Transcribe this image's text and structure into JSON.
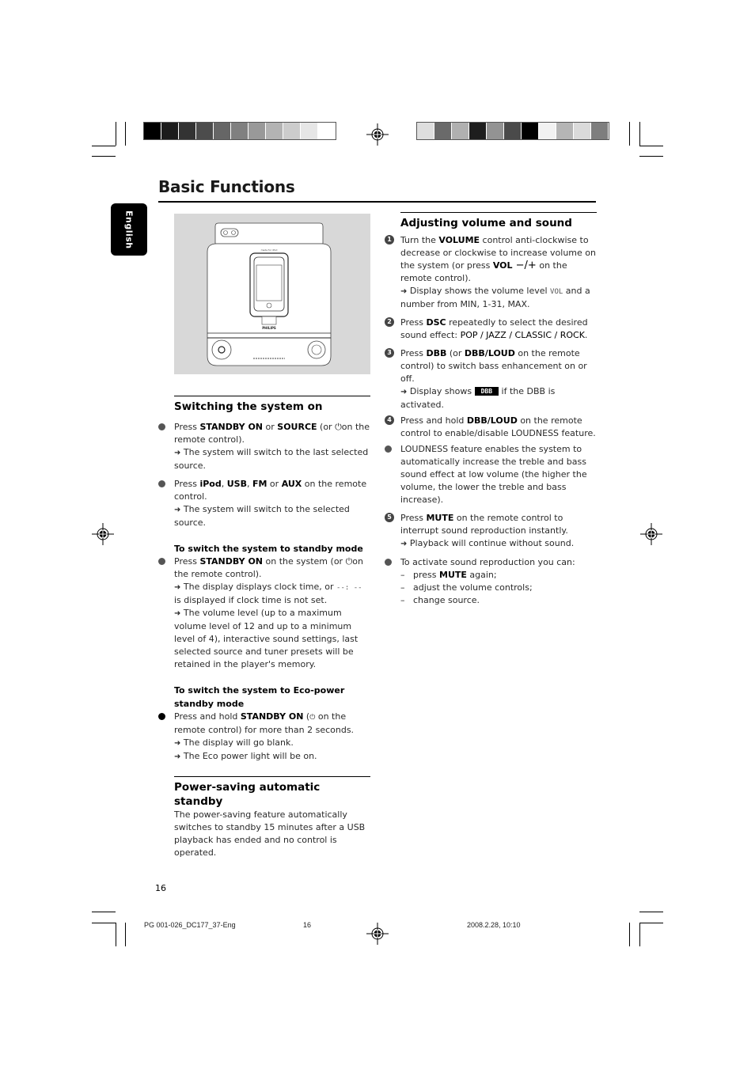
{
  "header": {
    "swatches_left": [
      "#000000",
      "#1c1c1c",
      "#333333",
      "#4c4c4c",
      "#666666",
      "#808080",
      "#999999",
      "#b3b3b3",
      "#cccccc",
      "#e6e6e6",
      "#ffffff"
    ],
    "swatches_right": [
      "#dedede",
      "#6a6a6a",
      "#b0b0b0",
      "#1e1e1e",
      "#939393",
      "#4a4a4a",
      "#000000",
      "#f2f2f2",
      "#b5b5b5",
      "#dadada",
      "#7e7e7e"
    ]
  },
  "page": {
    "title": "Basic Functions",
    "language_tab": "English",
    "page_number": "16"
  },
  "illustration": {
    "brand": "PHILIPS",
    "description": "iPod docking speaker system front view"
  },
  "left": {
    "switch_on": {
      "heading": "Switching the system on",
      "items": [
        {
          "press": "Press ",
          "k1": "STANDBY ON",
          "or": " or ",
          "k2": "SOURCE",
          "tail1": " (or ",
          "tail2": "on the remote control).",
          "result": " The system will switch to the last selected source."
        },
        {
          "press": "Press ",
          "k1": "iPod",
          "c1": ", ",
          "k2": "USB",
          "c2": ", ",
          "k3": "FM",
          "or": " or  ",
          "k4": "AUX",
          "tail": " on the remote control.",
          "result": " The system will switch to the selected source."
        }
      ]
    },
    "standby": {
      "heading": "To switch the system to standby mode",
      "press": "Press ",
      "key": "STANDBY ON",
      "tail1": " on the system (or ",
      "tail2": "on the  remote control).",
      "result1a": " The display displays clock time, or ",
      "clock_blank": "--:  --",
      "result1b": "  is displayed if clock time is not set.",
      "result2": " The volume level (up to a maximum volume level of 12 and up to a minimum level of 4), interactive sound settings, last selected source and tuner presets will be retained in the player's memory."
    },
    "eco": {
      "heading": "To switch the system to Eco-power standby mode",
      "press": "Press and hold ",
      "key": "STANDBY ON",
      "tail1": " (",
      "tail2": " on the remote control) for more than 2 seconds.",
      "result1": " The display will go blank.",
      "result2": " The Eco power light will be on."
    },
    "power_saving": {
      "heading": "Power-saving automatic standby",
      "body": "The power-saving feature automatically switches to standby 15 minutes after a USB playback has ended and no control is operated."
    }
  },
  "right": {
    "heading": "Adjusting volume and sound",
    "step1": {
      "num": "1",
      "a": "Turn the ",
      "k1": "VOLUME",
      "b": " control anti-clockwise to decrease or clockwise to increase volume on the system (or press ",
      "k2": "VOL",
      "k2b": " −/+",
      "c": " on the remote control).",
      "result_a": " Display shows the volume level ",
      "vol_display": "VOL",
      "result_b": " and a number from MIN, 1-31, MAX."
    },
    "step2": {
      "num": "2",
      "a": "Press ",
      "k1": "DSC",
      "b": " repeatedly to select the desired sound effect: ",
      "effects": "POP / JAZZ / CLASSIC / ROCK",
      "c": "."
    },
    "step3": {
      "num": "3",
      "a": "Press ",
      "k1": "DBB",
      "b": " (or ",
      "k2": "DBB/LOUD",
      "c": " on the remote control) to switch bass enhancement on or off.",
      "result_a": " Display shows ",
      "badge": "DBB",
      "result_b": " if the DBB is activated."
    },
    "step4": {
      "num": "4",
      "a": "Press and hold ",
      "k1": "DBB/LOUD",
      "b": " on the remote control to enable/disable LOUDNESS feature."
    },
    "loudness_note": "LOUDNESS feature enables the system to automatically increase the treble and bass sound effect at low volume (the higher the volume, the lower the treble and bass increase).",
    "step5": {
      "num": "5",
      "a": "Press ",
      "k1": "MUTE",
      "b": " on the remote control to interrupt sound reproduction instantly.",
      "result": " Playback will continue without sound."
    },
    "reactivate": {
      "intro": "To activate sound reproduction you can:",
      "opt1a": "press ",
      "opt1k": "MUTE",
      "opt1b": " again;",
      "opt2": "adjust the volume controls;",
      "opt3": "change source."
    }
  },
  "footer": {
    "file": "PG 001-026_DC177_37-Eng",
    "page": "16",
    "datetime": "2008.2.28, 10:10"
  }
}
